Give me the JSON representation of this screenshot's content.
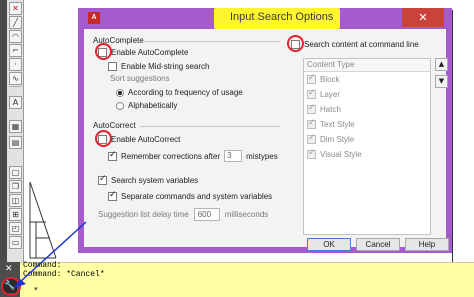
{
  "dialog": {
    "title": "Input Search Options",
    "close": "✕",
    "autocomplete": {
      "heading": "AutoComplete",
      "enable": "Enable AutoComplete",
      "midstring": "Enable Mid-string search",
      "sort_label": "Sort suggestions",
      "sort_freq": "According to frequency of usage",
      "sort_alpha": "Alphabetically"
    },
    "autocorrect": {
      "heading": "AutoCorrect",
      "enable": "Enable AutoCorrect",
      "remember": "Remember corrections after",
      "mistypes_value": "3",
      "mistypes_label": "mistypes"
    },
    "search_system_vars": "Search system variables",
    "separate": "Separate commands and system variables",
    "delay_label": "Suggestion list delay time",
    "delay_value": "600",
    "delay_unit": "milliseconds",
    "search_content": "Search content at command line",
    "content_type": {
      "header": "Content Type",
      "items": [
        "Block",
        "Layer",
        "Hatch",
        "Text Style",
        "Dim Style",
        "Visual Style"
      ]
    },
    "buttons": {
      "ok": "OK",
      "cancel": "Cancel",
      "help": "Help"
    }
  },
  "command_line": {
    "line1": "Command:",
    "line2": "Command: *Cancel*",
    "close": "✕"
  },
  "colors": {
    "dialog_frame": "#a55bcd",
    "title_highlight": "#fff52e",
    "annotation_ring": "#e0242f",
    "command_bg": "#ffffa6",
    "arrow": "#1d32d6"
  },
  "icons": [
    "app-logo-icon",
    "close-icon",
    "up-arrow-icon",
    "down-arrow-icon",
    "wrench-icon",
    "pointer-arrow-icon"
  ]
}
